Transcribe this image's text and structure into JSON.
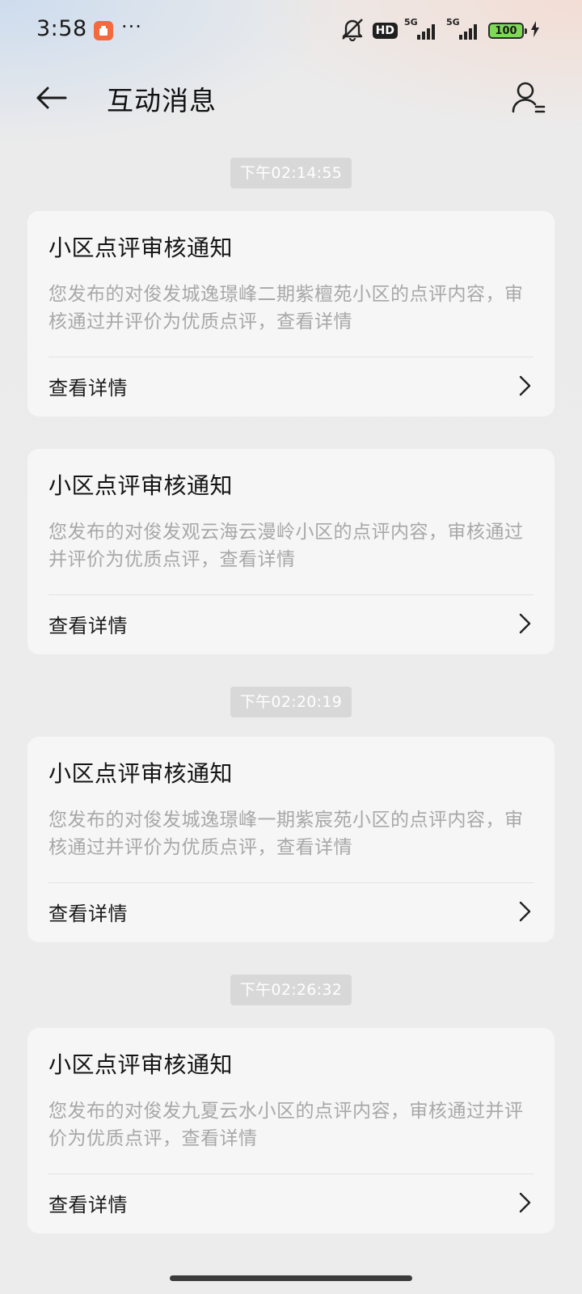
{
  "status_bar": {
    "time": "3:58",
    "more": "···",
    "hd_label": "HD",
    "sim1_label": "5G",
    "sim2_label": "5G",
    "battery": "100",
    "icons": [
      "muted-bell-icon",
      "hd-icon",
      "signal-icon",
      "signal-icon",
      "battery-icon",
      "charging-icon"
    ]
  },
  "header": {
    "title": "互动消息",
    "back_icon": "arrow-left-icon",
    "profile_icon": "user-list-icon"
  },
  "feed": [
    {
      "timestamp": "下午02:14:55",
      "title": "小区点评审核通知",
      "body": "您发布的对俊发城逸璟峰二期紫檀苑小区的点评内容，审核通过并评价为优质点评，查看详情",
      "link": "查看详情"
    },
    {
      "timestamp": "",
      "title": "小区点评审核通知",
      "body": "您发布的对俊发观云海云漫岭小区的点评内容，审核通过并评价为优质点评，查看详情",
      "link": "查看详情"
    },
    {
      "timestamp": "下午02:20:19",
      "title": "小区点评审核通知",
      "body": "您发布的对俊发城逸璟峰一期紫宸苑小区的点评内容，审核通过并评价为优质点评，查看详情",
      "link": "查看详情"
    },
    {
      "timestamp": "下午02:26:32",
      "title": "小区点评审核通知",
      "body": "您发布的对俊发九夏云水小区的点评内容，审核通过并评价为优质点评，查看详情",
      "link": "查看详情"
    }
  ]
}
